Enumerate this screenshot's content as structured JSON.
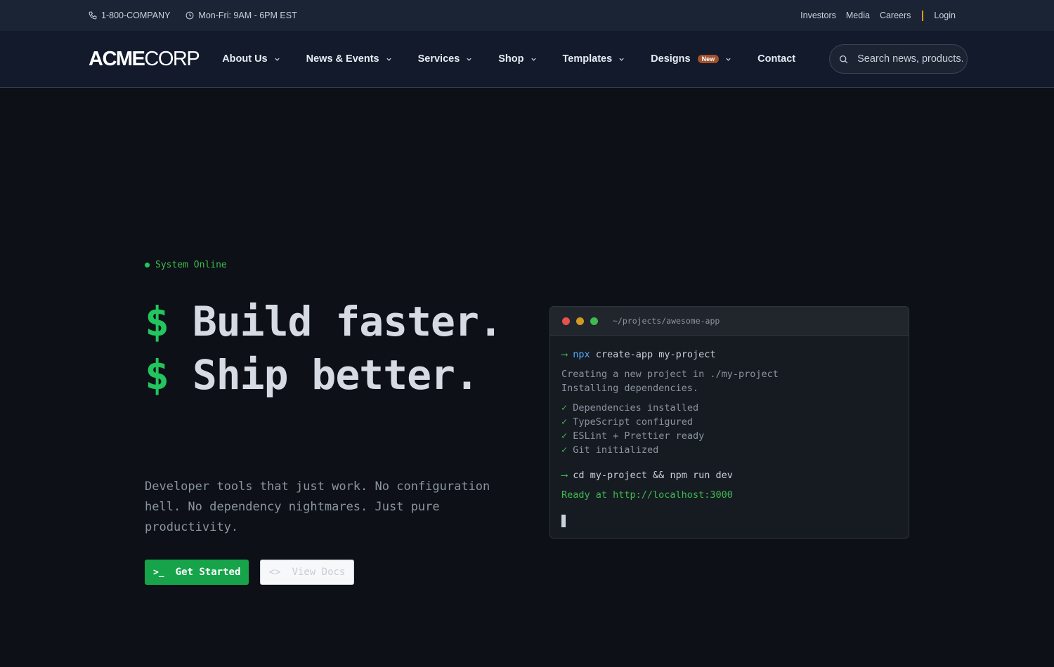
{
  "topbar": {
    "phone": "1-800-COMPANY",
    "hours": "Mon-Fri: 9AM - 6PM EST",
    "links": [
      "Investors",
      "Media",
      "Careers"
    ],
    "login": "Login"
  },
  "header": {
    "logo_bold": "ACME",
    "logo_light": "CORP",
    "nav": {
      "about": "About Us",
      "news": "News & Events",
      "services": "Services",
      "shop": "Shop",
      "templates": "Templates",
      "designs": "Designs",
      "designs_badge": "New",
      "contact": "Contact"
    },
    "search_placeholder": "Search news, products..."
  },
  "hero": {
    "status": "System Online",
    "dollar": "$",
    "line1": " Build faster.",
    "line2": " Ship better.",
    "description": "Developer tools that just work. No configuration hell. No dependency nightmares. Just pure productivity.",
    "primary_icon": ">_",
    "primary_label": "Get Started",
    "secondary_icon": "<>",
    "secondary_label": "View Docs"
  },
  "terminal": {
    "path": "~/projects/awesome-app",
    "arrow": "⟶",
    "cmd1_bin": "npx",
    "cmd1_rest": " create-app my-project",
    "out1": "Creating a new project in ./my-project",
    "out2": "Installing dependencies.",
    "check": "✓",
    "checks": [
      "Dependencies installed",
      "TypeScript configured",
      "ESLint + Prettier ready",
      "Git initialized"
    ],
    "cmd2": " cd my-project && npm run dev",
    "ready": "Ready at http://localhost:3000"
  },
  "colors": {
    "accent_green": "#22c55e",
    "button_green": "#16a34a",
    "badge": "#a0522d",
    "separator": "#d4a017",
    "traffic_red": "#e5534b",
    "traffic_yellow": "#d29922",
    "traffic_green": "#3fb950"
  }
}
